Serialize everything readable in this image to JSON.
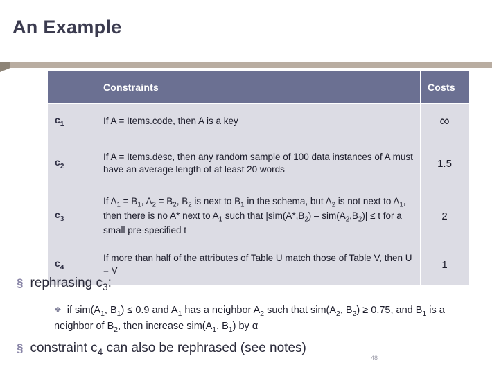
{
  "slide": {
    "title": "An Example",
    "page_number": "48"
  },
  "table": {
    "headers": {
      "id": "",
      "constraints": "Constraints",
      "costs": "Costs"
    },
    "rows": [
      {
        "id_base": "c",
        "id_sub": "1",
        "constraint_html": "If A = Items.code, then A is a key",
        "cost": "∞",
        "cost_is_infinity": true
      },
      {
        "id_base": "c",
        "id_sub": "2",
        "constraint_html": "If A = Items.desc, then any random sample of 100 data instances of A must have an average length of at least 20 words",
        "cost": "1.5",
        "cost_is_infinity": false
      },
      {
        "id_base": "c",
        "id_sub": "3",
        "constraint_html": "If A<sub>1</sub> = B<sub>1</sub>, A<sub>2</sub> = B<sub>2</sub>, B<sub>2</sub> is next to B<sub>1</sub> in the schema, but A<sub>2</sub> is not next to A<sub>1</sub>, then there is no A* next to A<sub>1</sub> such that |sim(A*,B<sub>2</sub>) &ndash; sim(A<sub>2</sub>,B<sub>2</sub>)| &le; t for a small pre-specified t",
        "cost": "2",
        "cost_is_infinity": false
      },
      {
        "id_base": "c",
        "id_sub": "4",
        "constraint_html": "If more than half of the attributes of Table U match those of Table V, then U = V",
        "cost": "1",
        "cost_is_infinity": false
      }
    ]
  },
  "bullets": {
    "first_html": "rephrasing c<sub>3</sub>:",
    "sub_html": "if sim(A<sub>1</sub>, B<sub>1</sub>) &le; 0.9 and A<sub>1</sub> has a neighbor A<sub>2</sub> such that sim(A<sub>2</sub>, B<sub>2</sub>) &ge; 0.75, and B<sub>1</sub> is a neighbor of B<sub>2</sub>, then increase sim(A<sub>1</sub>, B<sub>1</sub>) by &alpha;",
    "second_html": "constraint c<sub>4</sub> can also be rephrased (see notes)",
    "marker_level1": "§",
    "marker_level2": "❖"
  },
  "colors": {
    "header_bg": "#6b7092",
    "cell_bg": "#dcdce4",
    "title": "#3b3b4f",
    "rule": "#b9ada1"
  }
}
